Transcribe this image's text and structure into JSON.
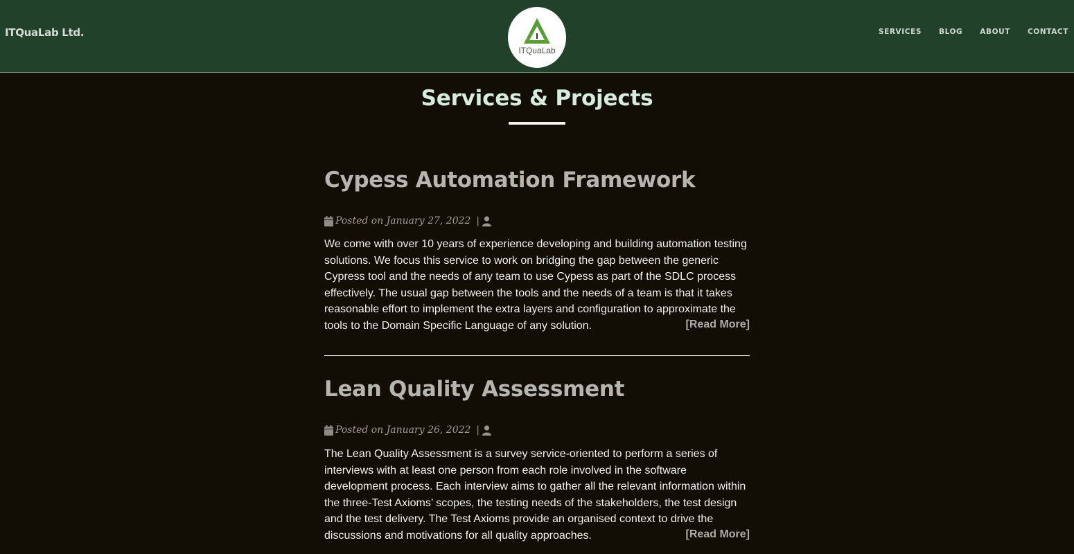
{
  "header": {
    "brand": "ITQuaLab Ltd.",
    "logo_text": "ITQuaLab",
    "nav": [
      "SERVICES",
      "BLOG",
      "ABOUT",
      "CONTACT"
    ]
  },
  "main": {
    "title": "Services & Projects",
    "posts": [
      {
        "title": "Cypess Automation Framework",
        "meta": "Posted on January 27, 2022",
        "separator": "|",
        "body": "We come with over 10 years of experience developing and building automation testing solutions. We focus this service to work on bridging the gap between the generic Cypress tool and the needs of any team to use Cypess as part of the SDLC process effectively. The usual gap between the tools and the needs of a team is that it takes reasonable effort to implement the extra layers and configuration to approximate the tools to the Domain Specific Language of any solution.",
        "read_more": "[Read More]"
      },
      {
        "title": "Lean Quality Assessment",
        "meta": "Posted on January 26, 2022",
        "separator": "|",
        "body": "The Lean Quality Assessment is a survey service-oriented to perform a series of interviews with at least one person from each role involved in the software development process. Each interview aims to gather all the relevant information within the three-Test Axioms’ scopes, the testing needs of the stakeholders, the test design and the test delivery. The Test Axioms provide an organised context to drive the discussions and motivations for all quality approaches.",
        "read_more": "[Read More]"
      }
    ]
  },
  "colors": {
    "navbar": "#22412a",
    "page_background": "#120d05",
    "page_title": "#d6ecdd",
    "post_title": "#b7b5b0",
    "body_text": "#f1f1ee",
    "logo_green": "#5a9e3a"
  },
  "icons": {
    "date": "calendar-icon",
    "author": "user-icon"
  }
}
